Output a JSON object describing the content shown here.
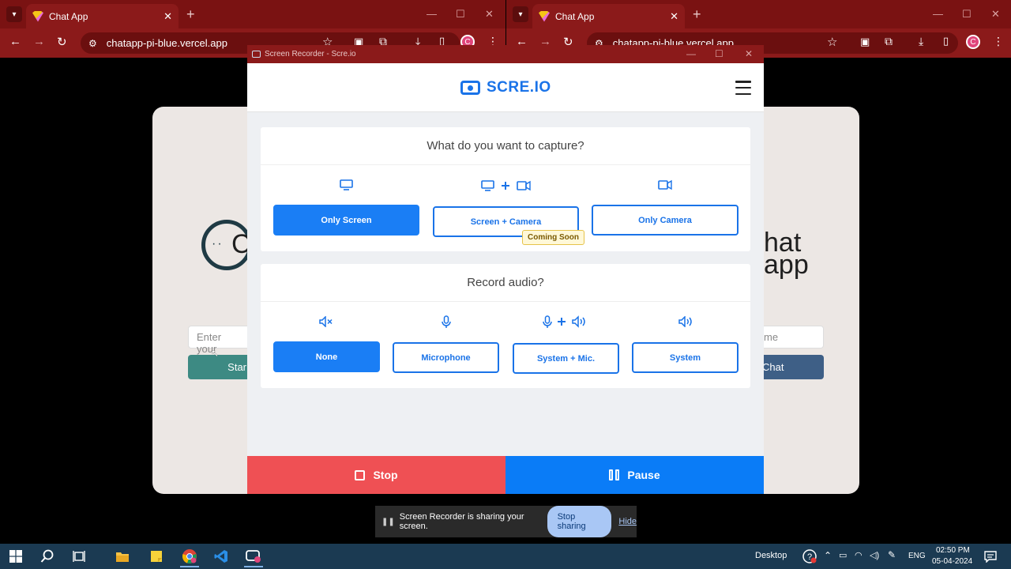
{
  "browser_left": {
    "tab_title": "Chat App",
    "url": "chatapp-pi-blue.vercel.app"
  },
  "browser_right": {
    "tab_title": "Chat App",
    "url": "chatapp-pi-blue.vercel.app"
  },
  "chat_app": {
    "logo_left": "C",
    "logo_right_line1": "hat",
    "logo_right_line2": "app",
    "input_left_placeholder": "Enter your",
    "input_right_placeholder": "me",
    "btn_left": "Star",
    "btn_right": "Chat"
  },
  "recorder": {
    "window_title": "Screen Recorder - Scre.io",
    "brand": "SCRE.IO",
    "capture": {
      "title": "What do you want to capture?",
      "options": [
        {
          "label": "Only Screen",
          "selected": true
        },
        {
          "label": "Screen + Camera",
          "selected": false
        },
        {
          "label": "Only Camera",
          "selected": false
        }
      ],
      "coming_soon": "Coming Soon"
    },
    "audio": {
      "title": "Record audio?",
      "options": [
        {
          "label": "None",
          "selected": true
        },
        {
          "label": "Microphone",
          "selected": false
        },
        {
          "label": "System + Mic.",
          "selected": false
        },
        {
          "label": "System",
          "selected": false
        }
      ]
    },
    "stop_label": "Stop",
    "pause_label": "Pause"
  },
  "share_bar": {
    "message": "Screen Recorder is sharing your screen.",
    "stop_label": "Stop sharing",
    "hide_label": "Hide"
  },
  "taskbar": {
    "desktop_label": "Desktop",
    "language": "ENG",
    "time": "02:50 PM",
    "date": "05-04-2024"
  },
  "colors": {
    "browser_frame": "#8b1a1a",
    "accent_blue": "#1a73e8",
    "stop_red": "#ef5054",
    "pause_blue": "#0a7cf7",
    "taskbar": "#1b3a52"
  }
}
